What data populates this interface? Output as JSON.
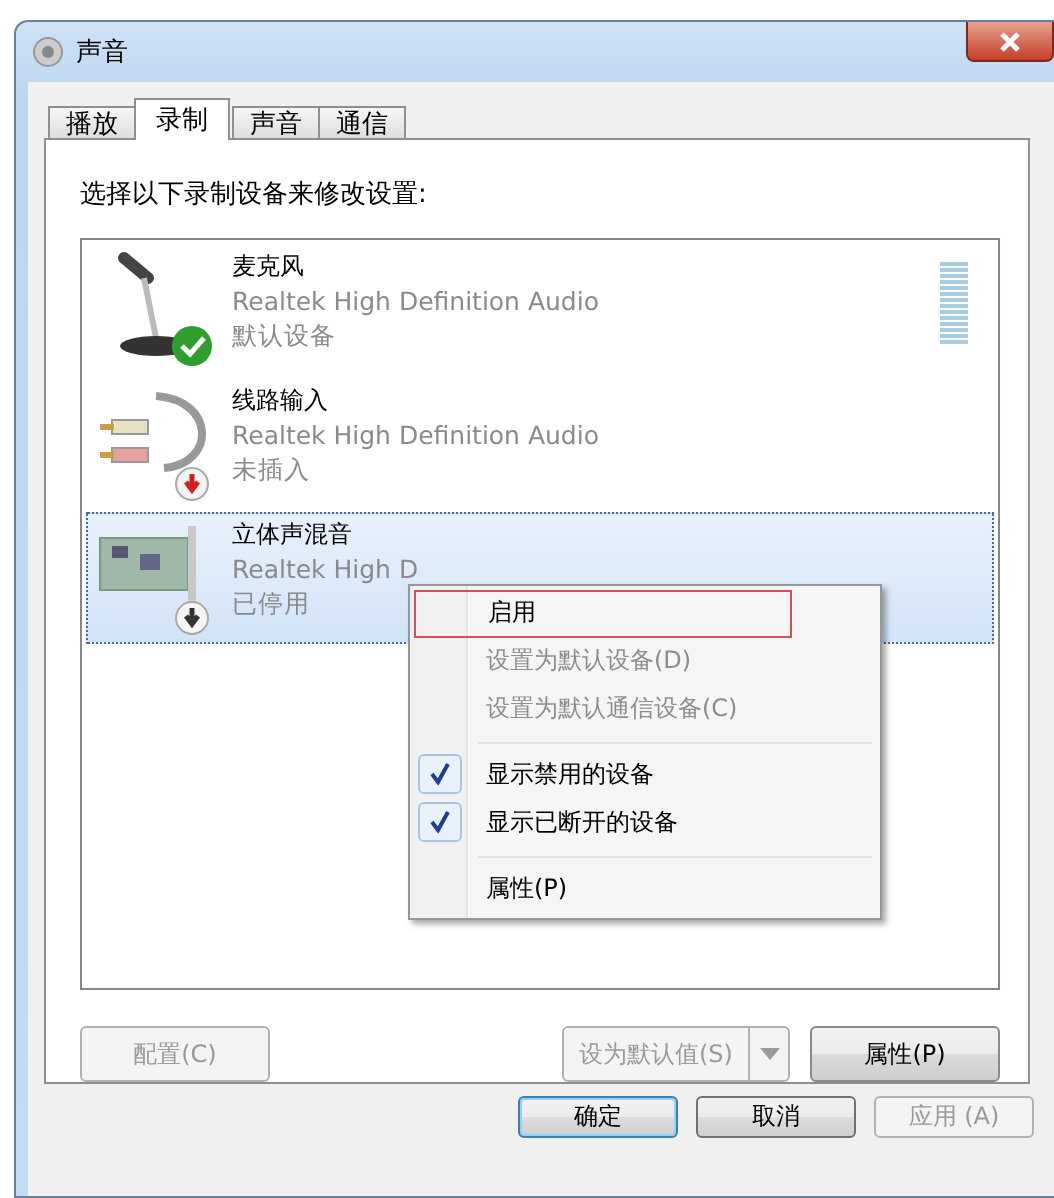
{
  "window": {
    "title": "声音"
  },
  "tabs": [
    {
      "label": "播放",
      "selected": false
    },
    {
      "label": "录制",
      "selected": true
    },
    {
      "label": "声音",
      "selected": false
    },
    {
      "label": "通信",
      "selected": false
    }
  ],
  "instruction": "选择以下录制设备来修改设置:",
  "devices": [
    {
      "kind": "microphone",
      "name": "麦克风",
      "driver": "Realtek High Definition Audio",
      "status": "默认设备",
      "default_device": true,
      "enabled": true,
      "plugged_in": true,
      "selected": false,
      "show_meter": true
    },
    {
      "kind": "line-in",
      "name": "线路输入",
      "driver": "Realtek High Definition Audio",
      "status": "未插入",
      "default_device": false,
      "enabled": true,
      "plugged_in": false,
      "selected": false,
      "show_meter": false
    },
    {
      "kind": "sound-card",
      "name": "立体声混音",
      "driver": "Realtek High D",
      "status": "已停用",
      "default_device": false,
      "enabled": false,
      "plugged_in": true,
      "selected": true,
      "show_meter": false
    }
  ],
  "context_menu": [
    {
      "kind": "item",
      "label": "启用",
      "disabled": false,
      "checked": false,
      "highlighted": true
    },
    {
      "kind": "item",
      "label": "设置为默认设备(D)",
      "disabled": true,
      "checked": false,
      "highlighted": false
    },
    {
      "kind": "item",
      "label": "设置为默认通信设备(C)",
      "disabled": true,
      "checked": false,
      "highlighted": false
    },
    {
      "kind": "separator"
    },
    {
      "kind": "item",
      "label": "显示禁用的设备",
      "disabled": false,
      "checked": true,
      "highlighted": false
    },
    {
      "kind": "item",
      "label": "显示已断开的设备",
      "disabled": false,
      "checked": true,
      "highlighted": false
    },
    {
      "kind": "separator"
    },
    {
      "kind": "item",
      "label": "属性(P)",
      "disabled": false,
      "checked": false,
      "highlighted": false
    }
  ],
  "panel_buttons": {
    "configure": {
      "label": "配置(C)",
      "disabled": true
    },
    "set_default": {
      "label": "设为默认值(S)",
      "disabled": true
    },
    "properties": {
      "label": "属性(P)",
      "disabled": false
    }
  },
  "dialog_buttons": [
    {
      "label": "确定",
      "disabled": false,
      "default": true
    },
    {
      "label": "取消",
      "disabled": false,
      "default": false
    },
    {
      "label": "应用 (A)",
      "disabled": true,
      "default": false
    }
  ]
}
